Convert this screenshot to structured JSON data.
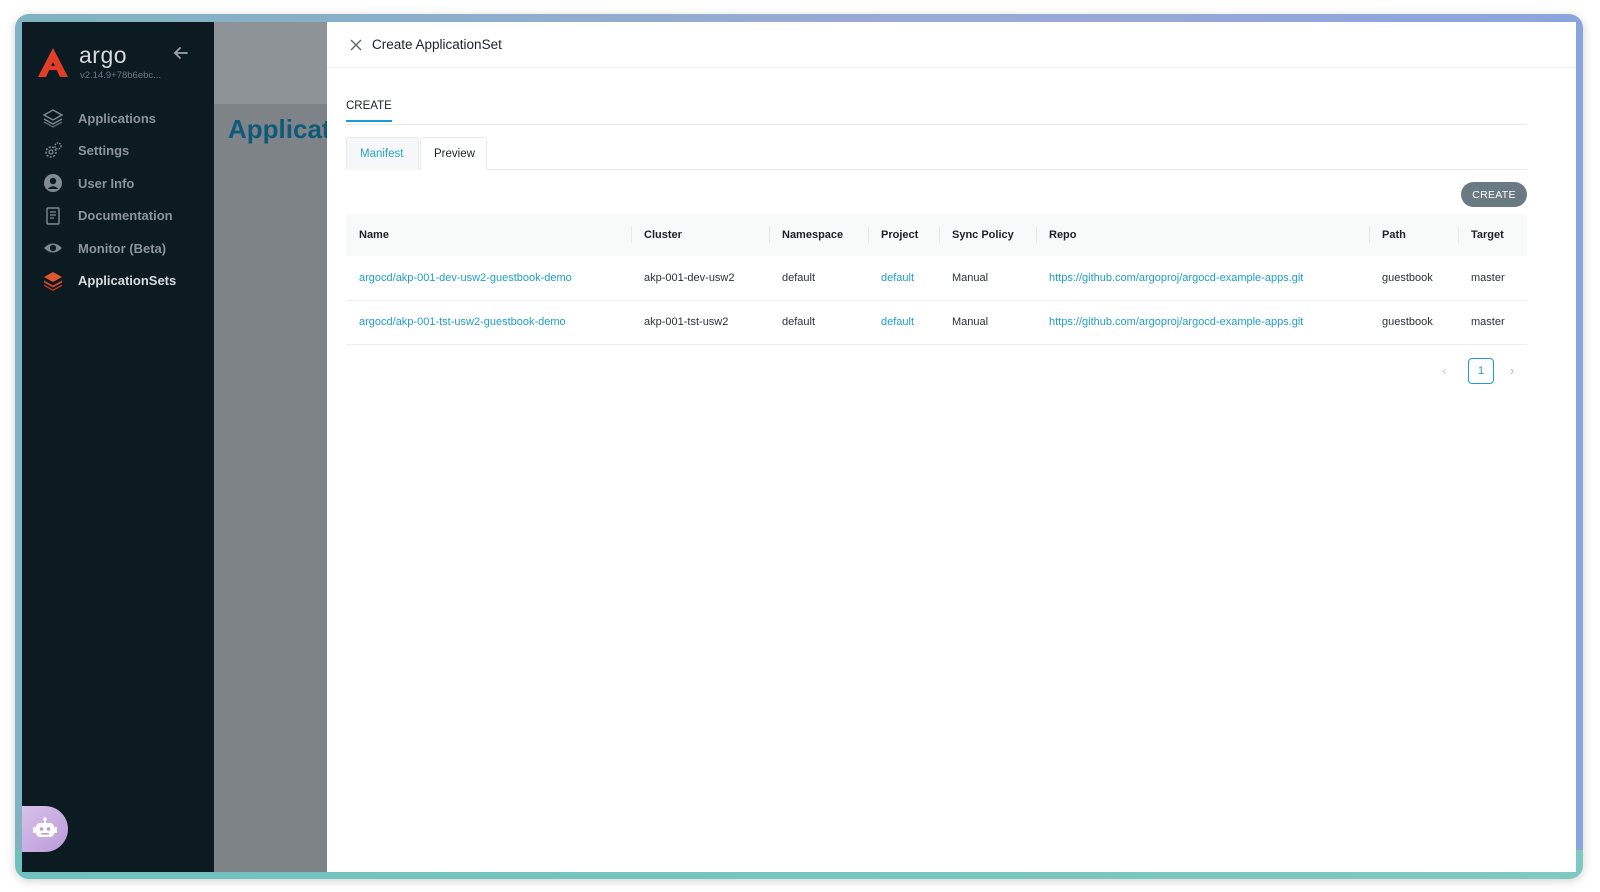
{
  "app": {
    "logo_text": "argo",
    "version": "v2.14.9+78b6ebc...",
    "brand_color": "#e23d28"
  },
  "sidebar": {
    "items": [
      {
        "label": "Applications",
        "icon": "layers-icon",
        "active": false
      },
      {
        "label": "Settings",
        "icon": "gears-icon",
        "active": false
      },
      {
        "label": "User Info",
        "icon": "user-circle-icon",
        "active": false
      },
      {
        "label": "Documentation",
        "icon": "document-icon",
        "active": false
      },
      {
        "label": "Monitor (Beta)",
        "icon": "eye-icon",
        "active": false
      },
      {
        "label": "ApplicationSets",
        "icon": "stack-icon",
        "active": true
      }
    ]
  },
  "background_page": {
    "title": "Applicati"
  },
  "panel": {
    "title": "Create ApplicationSet",
    "main_tab": "CREATE",
    "sub_tabs": {
      "manifest": "Manifest",
      "preview": "Preview"
    },
    "create_button": "CREATE",
    "table": {
      "headers": [
        "Name",
        "Cluster",
        "Namespace",
        "Project",
        "Sync Policy",
        "Repo",
        "Path",
        "Target"
      ],
      "rows": [
        {
          "name": "argocd/akp-001-dev-usw2-guestbook-demo",
          "cluster": "akp-001-dev-usw2",
          "namespace": "default",
          "project": "default",
          "sync_policy": "Manual",
          "repo": "https://github.com/argoproj/argocd-example-apps.git",
          "path": "guestbook",
          "target": "master"
        },
        {
          "name": "argocd/akp-001-tst-usw2-guestbook-demo",
          "cluster": "akp-001-tst-usw2",
          "namespace": "default",
          "project": "default",
          "sync_policy": "Manual",
          "repo": "https://github.com/argoproj/argocd-example-apps.git",
          "path": "guestbook",
          "target": "master"
        }
      ]
    },
    "pagination": {
      "current_page": "1",
      "prev": "‹",
      "next": "›"
    }
  },
  "colors": {
    "accent": "#1e9ad6",
    "link": "#1d9ec9",
    "sidebar_bg": "#0c1a21"
  }
}
